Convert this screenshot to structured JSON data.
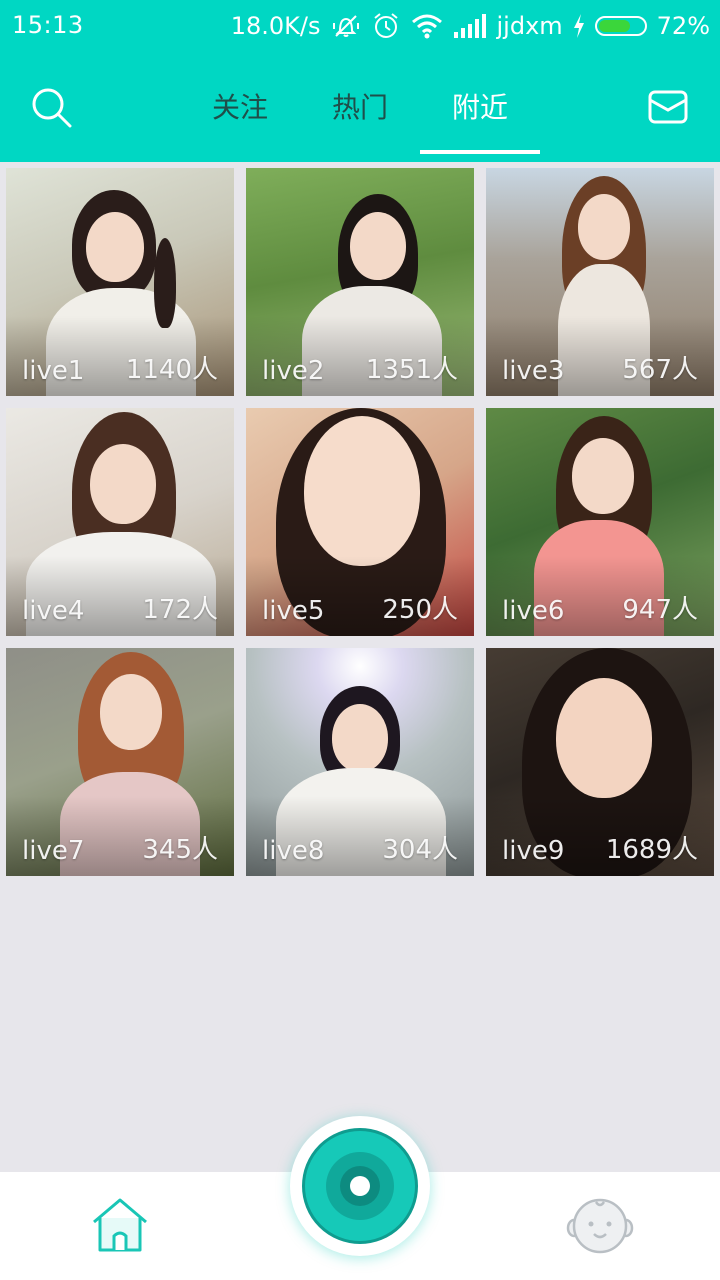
{
  "status_bar": {
    "time": "15:13",
    "net_speed": "18.0K/s",
    "carrier": "jjdxm",
    "battery_pct": "72%",
    "battery_level": 0.72,
    "icons": [
      "mute-vibrate-icon",
      "alarm-icon",
      "wifi-icon",
      "signal-icon",
      "charging-icon",
      "battery-icon"
    ]
  },
  "top_nav": {
    "search_icon": "search-icon",
    "mail_icon": "mail-icon",
    "tabs": [
      {
        "label": "关注",
        "active": false
      },
      {
        "label": "热门",
        "active": false
      },
      {
        "label": "附近",
        "active": true
      }
    ]
  },
  "lives": [
    {
      "name": "live1",
      "viewers": "1140人"
    },
    {
      "name": "live2",
      "viewers": "1351人"
    },
    {
      "name": "live3",
      "viewers": "567人"
    },
    {
      "name": "live4",
      "viewers": "172人"
    },
    {
      "name": "live5",
      "viewers": "250人"
    },
    {
      "name": "live6",
      "viewers": "947人"
    },
    {
      "name": "live7",
      "viewers": "345人"
    },
    {
      "name": "live8",
      "viewers": "304人"
    },
    {
      "name": "live9",
      "viewers": "1689人"
    }
  ],
  "bottom_bar": {
    "home_icon": "home-icon",
    "live_icon": "start-live-icon",
    "profile_icon": "profile-icon"
  },
  "colors": {
    "accent": "#00d7c3",
    "background": "#e7e6eb",
    "tab_inactive": "#1f4f4a",
    "home_active": "#19c6b6",
    "profile_inactive": "#b9bfc4"
  }
}
